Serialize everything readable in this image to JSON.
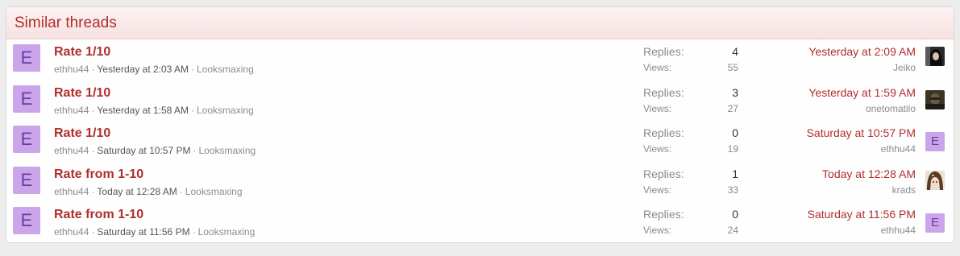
{
  "header": {
    "title": "Similar threads"
  },
  "labels": {
    "replies": "Replies:",
    "views": "Views:"
  },
  "threads": [
    {
      "avatar_letter": "E",
      "title": "Rate 1/10",
      "author": "ethhu44",
      "date": "Yesterday at 2:03 AM",
      "forum": "Looksmaxing",
      "replies": "4",
      "views": "55",
      "last_post_date": "Yesterday at 2:09 AM",
      "last_poster": "Jeiko",
      "last_poster_avatar": "photo-avatar-dark-hair"
    },
    {
      "avatar_letter": "E",
      "title": "Rate 1/10",
      "author": "ethhu44",
      "date": "Yesterday at 1:58 AM",
      "forum": "Looksmaxing",
      "replies": "3",
      "views": "27",
      "last_post_date": "Yesterday at 1:59 AM",
      "last_poster": "onetomatilo",
      "last_poster_avatar": "photo-avatar-dark"
    },
    {
      "avatar_letter": "E",
      "title": "Rate 1/10",
      "author": "ethhu44",
      "date": "Saturday at 10:57 PM",
      "forum": "Looksmaxing",
      "replies": "0",
      "views": "19",
      "last_post_date": "Saturday at 10:57 PM",
      "last_poster": "ethhu44",
      "last_poster_avatar_letter": "E"
    },
    {
      "avatar_letter": "E",
      "title": "Rate from 1-10",
      "author": "ethhu44",
      "date": "Today at 12:28 AM",
      "forum": "Looksmaxing",
      "replies": "1",
      "views": "33",
      "last_post_date": "Today at 12:28 AM",
      "last_poster": "krads",
      "last_poster_avatar": "anime-avatar"
    },
    {
      "avatar_letter": "E",
      "title": "Rate from 1-10",
      "author": "ethhu44",
      "date": "Saturday at 11:56 PM",
      "forum": "Looksmaxing",
      "replies": "0",
      "views": "24",
      "last_post_date": "Saturday at 11:56 PM",
      "last_poster": "ethhu44",
      "last_poster_avatar_letter": "E"
    }
  ],
  "colors": {
    "accent": "#b02e2e",
    "avatar_bg": "#cba5e9",
    "avatar_fg": "#6b3aa6"
  }
}
